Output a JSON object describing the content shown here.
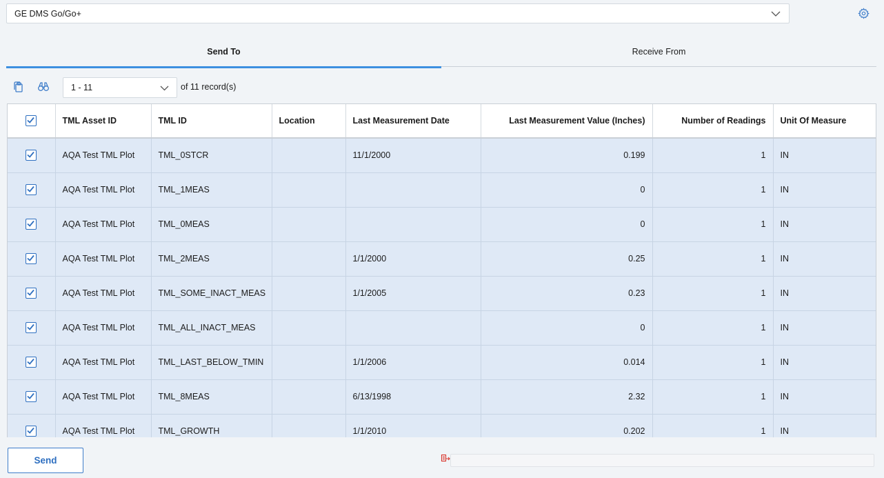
{
  "device_select": {
    "value": "GE DMS Go/Go+"
  },
  "tabs": [
    {
      "label": "Send To",
      "active": true
    },
    {
      "label": "Receive From",
      "active": false
    }
  ],
  "toolbar": {
    "range_value": "1 - 11",
    "records_text": "of 11 record(s)"
  },
  "grid": {
    "columns": [
      "TML Asset ID",
      "TML ID",
      "Location",
      "Last Measurement Date",
      "Last Measurement Value (Inches)",
      "Number of Readings",
      "Unit Of Measure"
    ],
    "rows": [
      {
        "asset": "AQA Test TML Plot",
        "tml": "TML_0STCR",
        "location": "",
        "date": "11/1/2000",
        "value": "0.199",
        "readings": "1",
        "uom": "IN"
      },
      {
        "asset": "AQA Test TML Plot",
        "tml": "TML_1MEAS",
        "location": "",
        "date": "",
        "value": "0",
        "readings": "1",
        "uom": "IN"
      },
      {
        "asset": "AQA Test TML Plot",
        "tml": "TML_0MEAS",
        "location": "",
        "date": "",
        "value": "0",
        "readings": "1",
        "uom": "IN"
      },
      {
        "asset": "AQA Test TML Plot",
        "tml": "TML_2MEAS",
        "location": "",
        "date": "1/1/2000",
        "value": "0.25",
        "readings": "1",
        "uom": "IN"
      },
      {
        "asset": "AQA Test TML Plot",
        "tml": "TML_SOME_INACT_MEAS",
        "location": "",
        "date": "1/1/2005",
        "value": "0.23",
        "readings": "1",
        "uom": "IN"
      },
      {
        "asset": "AQA Test TML Plot",
        "tml": "TML_ALL_INACT_MEAS",
        "location": "",
        "date": "",
        "value": "0",
        "readings": "1",
        "uom": "IN"
      },
      {
        "asset": "AQA Test TML Plot",
        "tml": "TML_LAST_BELOW_TMIN",
        "location": "",
        "date": "1/1/2006",
        "value": "0.014",
        "readings": "1",
        "uom": "IN"
      },
      {
        "asset": "AQA Test TML Plot",
        "tml": "TML_8MEAS",
        "location": "",
        "date": "6/13/1998",
        "value": "2.32",
        "readings": "1",
        "uom": "IN"
      },
      {
        "asset": "AQA Test TML Plot",
        "tml": "TML_GROWTH",
        "location": "",
        "date": "1/1/2010",
        "value": "0.202",
        "readings": "1",
        "uom": "IN"
      }
    ]
  },
  "footer": {
    "send_label": "Send"
  },
  "icons": {
    "gear": "gear-icon",
    "copy": "copy-icon",
    "find": "binoculars-icon",
    "progress": "progress-icon"
  },
  "colors": {
    "accent": "#3d8fe0",
    "row_bg": "#dfe9f6",
    "link": "#2e6fc0"
  }
}
